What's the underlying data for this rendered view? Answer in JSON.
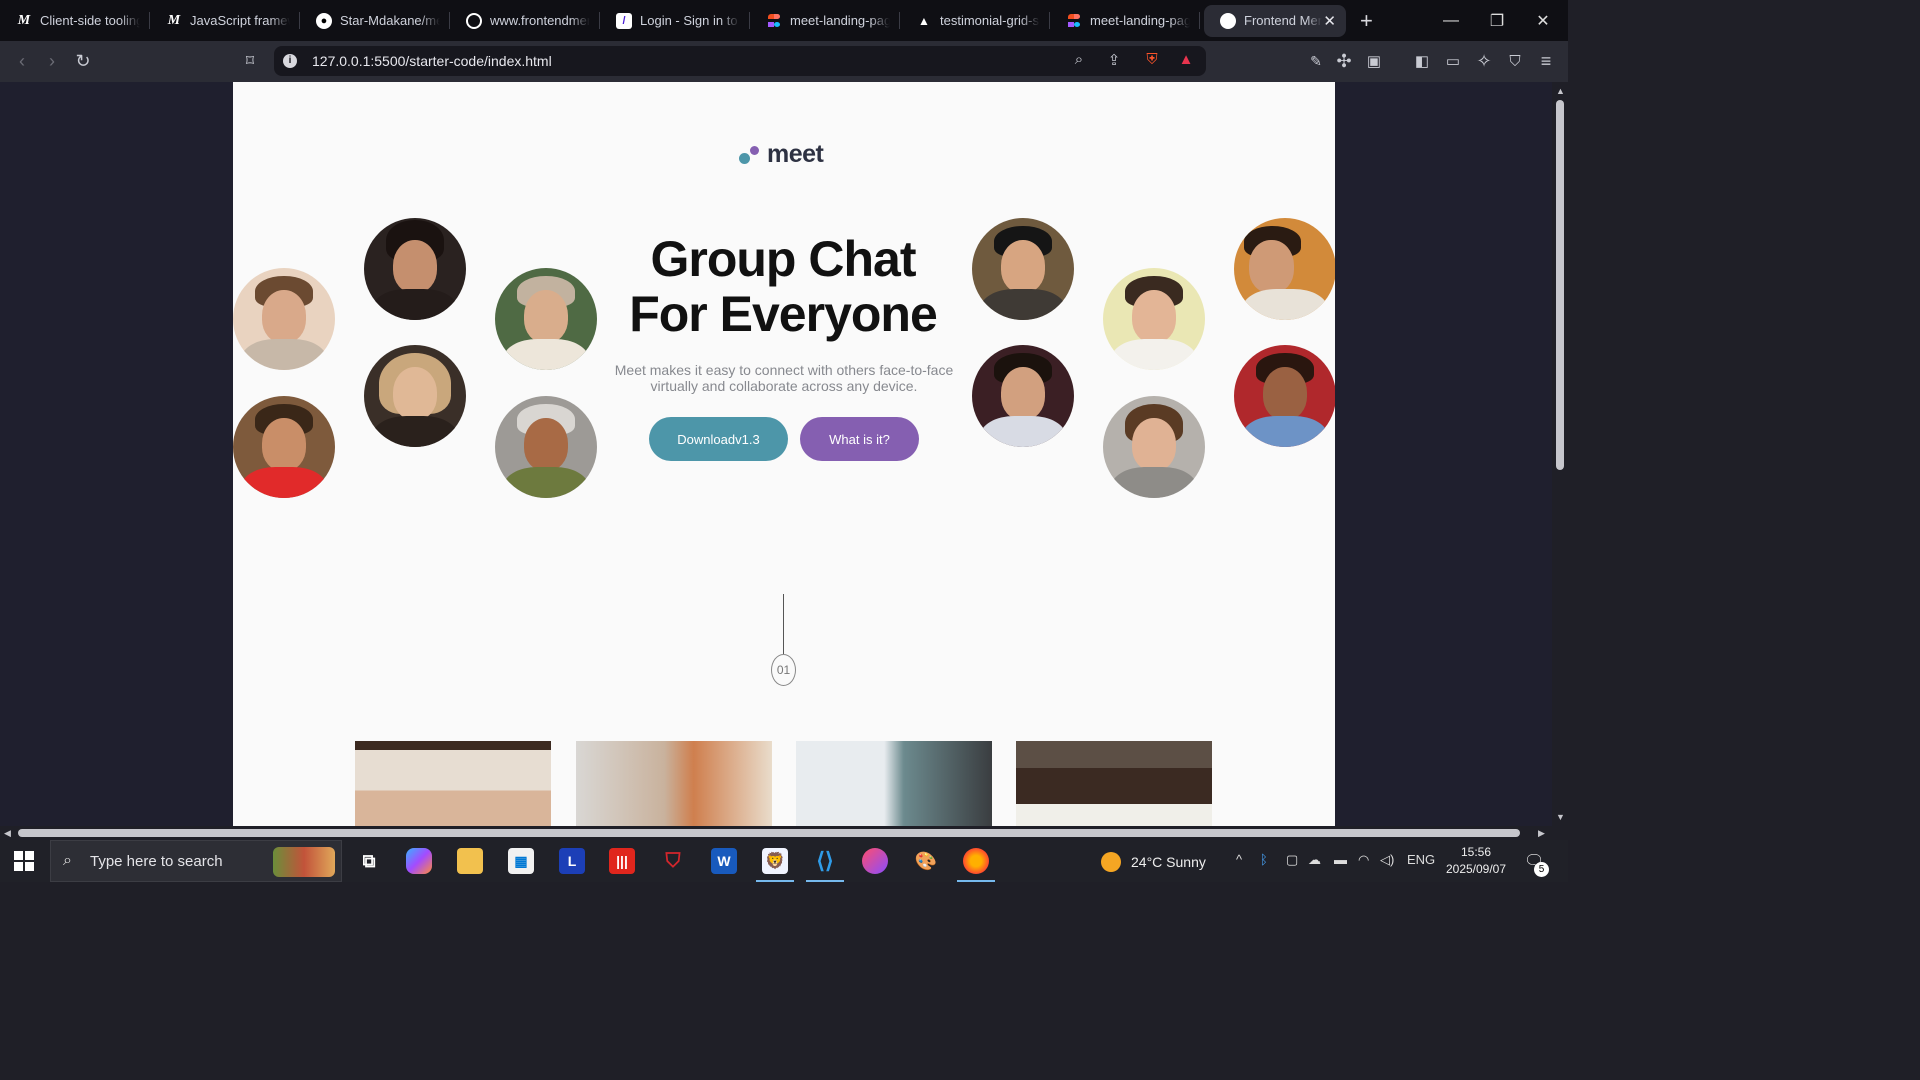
{
  "browser": {
    "tabs": [
      {
        "title": "Client-side tooling",
        "icon": "mdn-icon"
      },
      {
        "title": "JavaScript framew",
        "icon": "mdn-icon"
      },
      {
        "title": "Star-Mdakane/me",
        "icon": "github-icon"
      },
      {
        "title": "www.frontendmen",
        "icon": "frontendmentor-icon"
      },
      {
        "title": "Login - Sign in to",
        "icon": "login-icon"
      },
      {
        "title": "meet-landing-pag",
        "icon": "figma-icon"
      },
      {
        "title": "testimonial-grid-s",
        "icon": "triangle-icon"
      },
      {
        "title": "meet-landing-pag",
        "icon": "figma-icon"
      },
      {
        "title": "Frontend Men",
        "icon": "frontendmentor-icon",
        "active": true
      }
    ],
    "new_tab_label": "+",
    "url": "127.0.0.1:5500/starter-code/index.html"
  },
  "page": {
    "logo_text": "meet",
    "hero": {
      "title_line1": "Group Chat",
      "title_line2": "For Everyone",
      "subtitle": "Meet makes it easy to connect with others face-to-face virtually and collaborate across any device.",
      "download_label": "Downloadv1.3",
      "what_label": "What is it?"
    },
    "step_number": "01",
    "colors": {
      "cyan": "#4d96a9",
      "purple": "#855fb1",
      "heading": "#111111",
      "body_text": "#87898f"
    }
  },
  "taskbar": {
    "search_placeholder": "Type here to search",
    "weather": "24°C  Sunny",
    "language": "ENG",
    "time": "15:56",
    "date": "2025/09/07",
    "notification_count": "5"
  }
}
